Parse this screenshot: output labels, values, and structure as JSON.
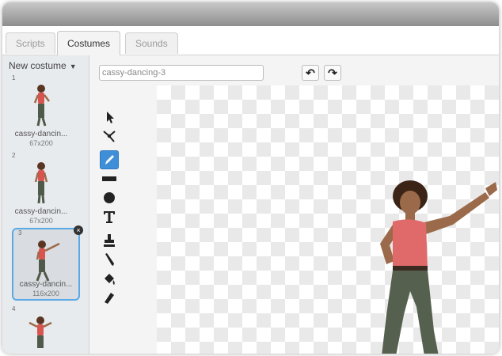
{
  "tabs": [
    {
      "label": "Scripts"
    },
    {
      "label": "Costumes"
    },
    {
      "label": "Sounds"
    }
  ],
  "sidebar": {
    "new_costume_label": "New costume",
    "costumes": [
      {
        "number": "1",
        "name": "cassy-dancin...",
        "size": "67x200"
      },
      {
        "number": "2",
        "name": "cassy-dancin...",
        "size": "67x200"
      },
      {
        "number": "3",
        "name": "cassy-dancin...",
        "size": "116x200"
      },
      {
        "number": "4",
        "name": "",
        "size": ""
      }
    ]
  },
  "editor": {
    "costume_name_value": "cassy-dancing-3"
  },
  "colors": {
    "accent": "#3e8fd8",
    "selection_border": "#5aa9e6"
  },
  "icons": [
    "undo-icon",
    "redo-icon",
    "select-icon",
    "reshape-icon",
    "pencil-icon",
    "line-icon",
    "ellipse-icon",
    "text-icon",
    "stamp-icon",
    "eyedropper-icon",
    "fill-icon",
    "eraser-icon"
  ]
}
